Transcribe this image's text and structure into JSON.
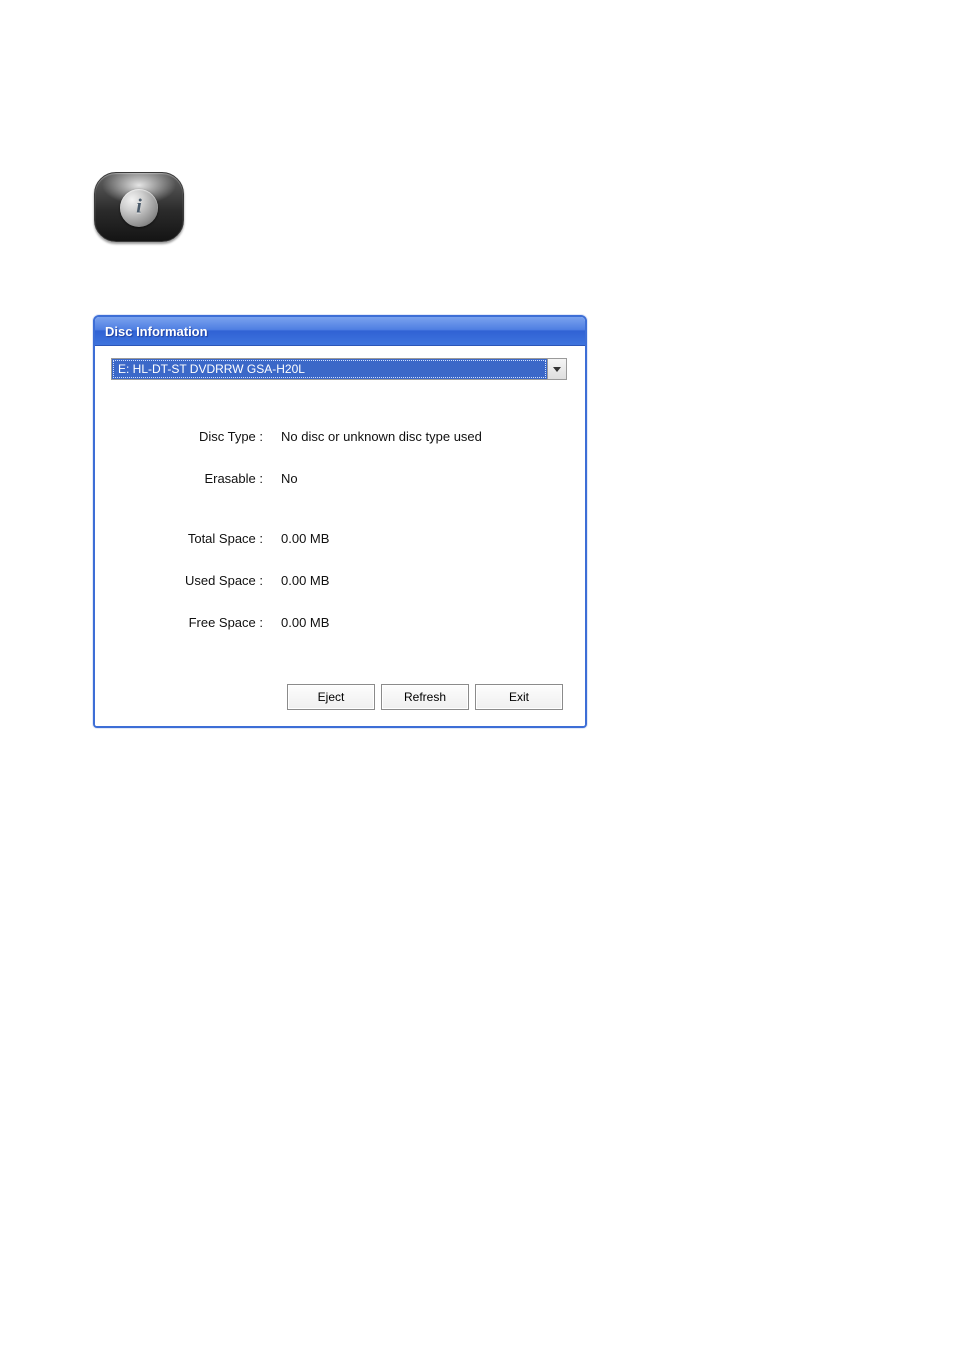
{
  "dialog": {
    "title": "Disc Information",
    "drive_selected": "E: HL-DT-ST DVDRRW GSA-H20L",
    "fields": {
      "disc_type_label": "Disc Type :",
      "disc_type_value": "No disc or unknown disc type used",
      "erasable_label": "Erasable :",
      "erasable_value": "No",
      "total_space_label": "Total Space :",
      "total_space_value": "0.00 MB",
      "used_space_label": "Used Space :",
      "used_space_value": "0.00 MB",
      "free_space_label": "Free Space :",
      "free_space_value": "0.00 MB"
    },
    "buttons": {
      "eject": "Eject",
      "refresh": "Refresh",
      "exit": "Exit"
    }
  },
  "toolbar_icon": {
    "name": "info-icon",
    "glyph": "i"
  }
}
